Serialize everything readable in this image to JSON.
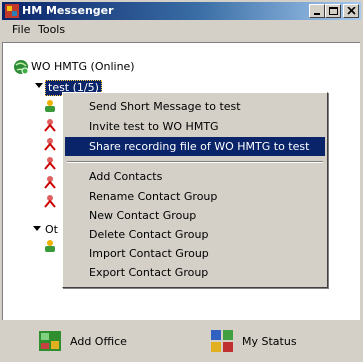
{
  "window": {
    "title": "HM Messenger"
  },
  "menubar": {
    "file": "File",
    "tools": "Tools"
  },
  "tree": {
    "root_label": "WO HMTG (Online)",
    "group_label": "test (1/5)",
    "group2_label": "Ot"
  },
  "context_menu": {
    "items": [
      "Send Short Message to test",
      "Invite test to WO HMTG",
      "Share recording file of WO HMTG to test",
      "Add Contacts",
      "Rename Contact Group",
      "New Contact Group",
      "Delete Contact Group",
      "Import Contact Group",
      "Export Contact Group"
    ],
    "selected_index": 2
  },
  "bottom": {
    "add_office": "Add Office",
    "my_status": "My Status"
  },
  "colors": {
    "highlight": "#0a246a",
    "face": "#d4d0c8"
  }
}
